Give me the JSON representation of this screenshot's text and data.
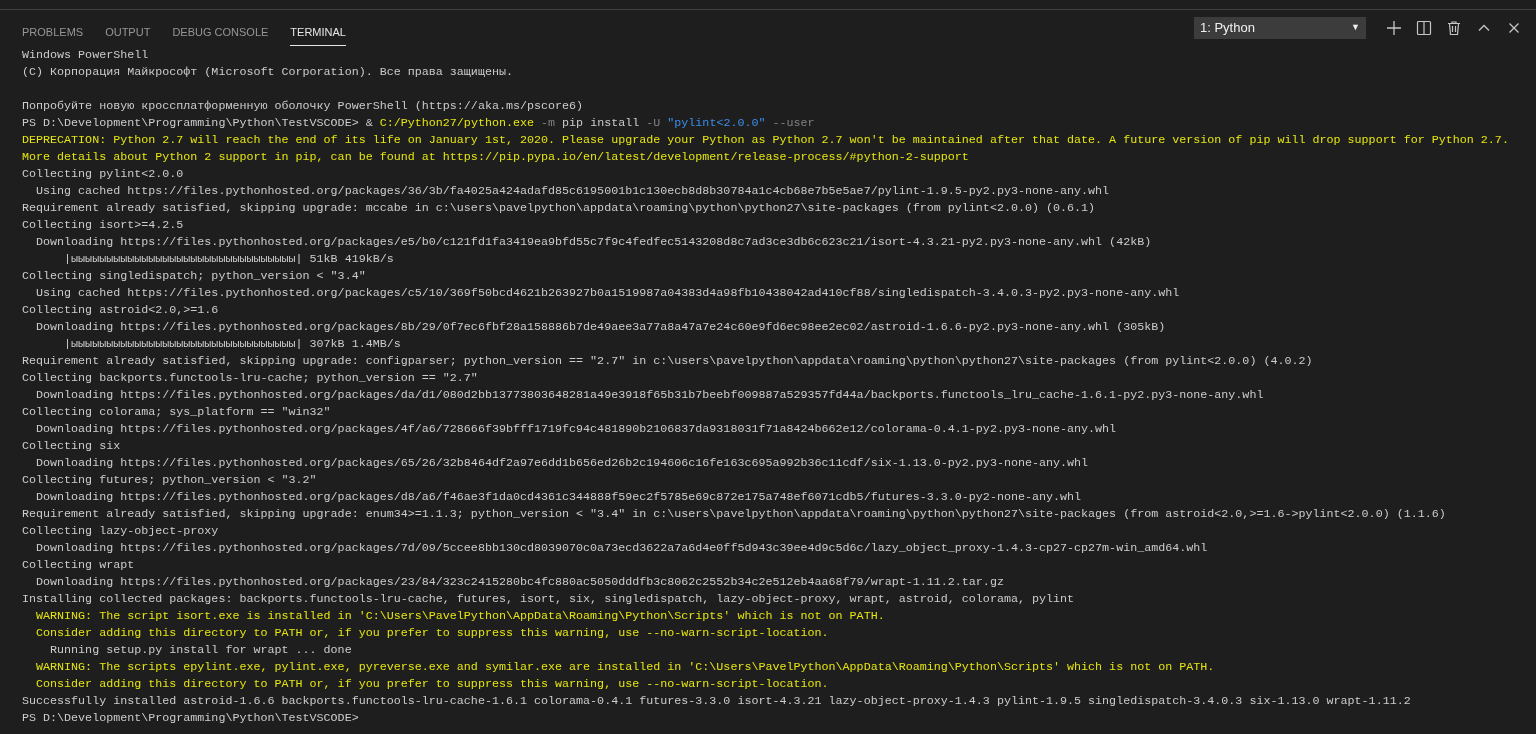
{
  "panel_tabs": [
    {
      "label": "PROBLEMS",
      "selected": false
    },
    {
      "label": "OUTPUT",
      "selected": false
    },
    {
      "label": "DEBUG CONSOLE",
      "selected": false
    },
    {
      "label": "TERMINAL",
      "selected": true
    }
  ],
  "terminal_select": {
    "value": "1: Python",
    "caret": "▼"
  },
  "terminal_lines": [
    {
      "kind": "output",
      "text": "Windows PowerShell"
    },
    {
      "kind": "output",
      "text": "(C) Корпорация Майкрософт (Microsoft Corporation). Все права защищены."
    },
    {
      "kind": "blank"
    },
    {
      "kind": "output",
      "text": "Попробуйте новую кроссплатформенную оболочку PowerShell (https://aka.ms/pscore6)"
    },
    {
      "kind": "command",
      "segments": [
        {
          "kind": "plain",
          "text": "PS D:\\Development\\Programming\\Python\\TestVSCODE> & "
        },
        {
          "kind": "exe",
          "text": "C:/Python27/python.exe"
        },
        {
          "kind": "flag",
          "text": " -m "
        },
        {
          "kind": "plain",
          "text": "pip install"
        },
        {
          "kind": "flag",
          "text": " -U "
        },
        {
          "kind": "string",
          "text": "\"pylint<2.0.0\""
        },
        {
          "kind": "flag",
          "text": " --user"
        }
      ]
    },
    {
      "kind": "warning",
      "text": "DEPRECATION: Python 2.7 will reach the end of its life on January 1st, 2020. Please upgrade your Python as Python 2.7 won't be maintained after that date. A future version of pip will drop support for Python 2.7."
    },
    {
      "kind": "warning",
      "text": "More details about Python 2 support in pip, can be found at https://pip.pypa.io/en/latest/development/release-process/#python-2-support"
    },
    {
      "kind": "output",
      "text": "Collecting pylint<2.0.0"
    },
    {
      "kind": "output",
      "text": "  Using cached https://files.pythonhosted.org/packages/36/3b/fa4025a424adafd85c6195001b1c130ecb8d8b30784a1c4cb68e7b5e5ae7/pylint-1.9.5-py2.py3-none-any.whl"
    },
    {
      "kind": "output",
      "text": "Requirement already satisfied, skipping upgrade: mccabe in c:\\users\\pavelpython\\appdata\\roaming\\python\\python27\\site-packages (from pylint<2.0.0) (0.6.1)"
    },
    {
      "kind": "output",
      "text": "Collecting isort>=4.2.5"
    },
    {
      "kind": "output",
      "text": "  Downloading https://files.pythonhosted.org/packages/e5/b0/c121fd1fa3419ea9bfd55c7f9c4fedfec5143208d8c7ad3ce3db6c623c21/isort-4.3.21-py2.py3-none-any.whl (42kB)"
    },
    {
      "kind": "output",
      "text": "      |ыыыыыыыыыыыыыыыыыыыыыыыыыыыыыыыы| 51kB 419kB/s"
    },
    {
      "kind": "output",
      "text": "Collecting singledispatch; python_version < \"3.4\""
    },
    {
      "kind": "output",
      "text": "  Using cached https://files.pythonhosted.org/packages/c5/10/369f50bcd4621b263927b0a1519987a04383d4a98fb10438042ad410cf88/singledispatch-3.4.0.3-py2.py3-none-any.whl"
    },
    {
      "kind": "output",
      "text": "Collecting astroid<2.0,>=1.6"
    },
    {
      "kind": "output",
      "text": "  Downloading https://files.pythonhosted.org/packages/8b/29/0f7ec6fbf28a158886b7de49aee3a77a8a47a7e24c60e9fd6ec98ee2ec02/astroid-1.6.6-py2.py3-none-any.whl (305kB)"
    },
    {
      "kind": "output",
      "text": "      |ыыыыыыыыыыыыыыыыыыыыыыыыыыыыыыыы| 307kB 1.4MB/s"
    },
    {
      "kind": "output",
      "text": "Requirement already satisfied, skipping upgrade: configparser; python_version == \"2.7\" in c:\\users\\pavelpython\\appdata\\roaming\\python\\python27\\site-packages (from pylint<2.0.0) (4.0.2)"
    },
    {
      "kind": "output",
      "text": "Collecting backports.functools-lru-cache; python_version == \"2.7\""
    },
    {
      "kind": "output",
      "text": "  Downloading https://files.pythonhosted.org/packages/da/d1/080d2bb13773803648281a49e3918f65b31b7beebf009887a529357fd44a/backports.functools_lru_cache-1.6.1-py2.py3-none-any.whl"
    },
    {
      "kind": "output",
      "text": "Collecting colorama; sys_platform == \"win32\""
    },
    {
      "kind": "output",
      "text": "  Downloading https://files.pythonhosted.org/packages/4f/a6/728666f39bfff1719fc94c481890b2106837da9318031f71a8424b662e12/colorama-0.4.1-py2.py3-none-any.whl"
    },
    {
      "kind": "output",
      "text": "Collecting six"
    },
    {
      "kind": "output",
      "text": "  Downloading https://files.pythonhosted.org/packages/65/26/32b8464df2a97e6dd1b656ed26b2c194606c16fe163c695a992b36c11cdf/six-1.13.0-py2.py3-none-any.whl"
    },
    {
      "kind": "output",
      "text": "Collecting futures; python_version < \"3.2\""
    },
    {
      "kind": "output",
      "text": "  Downloading https://files.pythonhosted.org/packages/d8/a6/f46ae3f1da0cd4361c344888f59ec2f5785e69c872e175a748ef6071cdb5/futures-3.3.0-py2-none-any.whl"
    },
    {
      "kind": "output",
      "text": "Requirement already satisfied, skipping upgrade: enum34>=1.1.3; python_version < \"3.4\" in c:\\users\\pavelpython\\appdata\\roaming\\python\\python27\\site-packages (from astroid<2.0,>=1.6->pylint<2.0.0) (1.1.6)"
    },
    {
      "kind": "output",
      "text": "Collecting lazy-object-proxy"
    },
    {
      "kind": "output",
      "text": "  Downloading https://files.pythonhosted.org/packages/7d/09/5ccee8bb130cd8039070c0a73ecd3622a7a6d4e0ff5d943c39ee4d9c5d6c/lazy_object_proxy-1.4.3-cp27-cp27m-win_amd64.whl"
    },
    {
      "kind": "output",
      "text": "Collecting wrapt"
    },
    {
      "kind": "output",
      "text": "  Downloading https://files.pythonhosted.org/packages/23/84/323c2415280bc4fc880ac5050dddfb3c8062c2552b34c2e512eb4aa68f79/wrapt-1.11.2.tar.gz"
    },
    {
      "kind": "output",
      "text": "Installing collected packages: backports.functools-lru-cache, futures, isort, six, singledispatch, lazy-object-proxy, wrapt, astroid, colorama, pylint"
    },
    {
      "kind": "warning",
      "text": "  WARNING: The script isort.exe is installed in 'C:\\Users\\PavelPython\\AppData\\Roaming\\Python\\Scripts' which is not on PATH."
    },
    {
      "kind": "warning",
      "text": "  Consider adding this directory to PATH or, if you prefer to suppress this warning, use --no-warn-script-location."
    },
    {
      "kind": "output",
      "text": "    Running setup.py install for wrapt ... done"
    },
    {
      "kind": "warning",
      "text": "  WARNING: The scripts epylint.exe, pylint.exe, pyreverse.exe and symilar.exe are installed in 'C:\\Users\\PavelPython\\AppData\\Roaming\\Python\\Scripts' which is not on PATH."
    },
    {
      "kind": "warning",
      "text": "  Consider adding this directory to PATH or, if you prefer to suppress this warning, use --no-warn-script-location."
    },
    {
      "kind": "output",
      "text": "Successfully installed astroid-1.6.6 backports.functools-lru-cache-1.6.1 colorama-0.4.1 futures-3.3.0 isort-4.3.21 lazy-object-proxy-1.4.3 pylint-1.9.5 singledispatch-3.4.0.3 six-1.13.0 wrapt-1.11.2"
    },
    {
      "kind": "output",
      "text": "PS D:\\Development\\Programming\\Python\\TestVSCODE>"
    }
  ]
}
